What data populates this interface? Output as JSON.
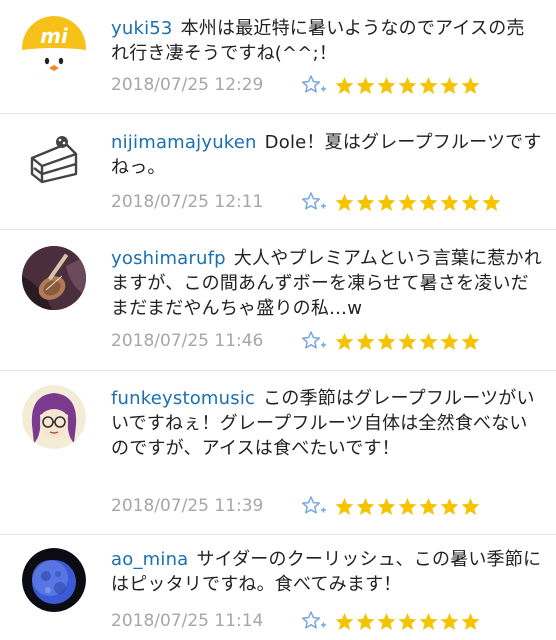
{
  "comments": [
    {
      "username": "yuki53",
      "text": "本州は最近特に暑いようなのでアイスの売れ行き凄そうですね(^^;！",
      "timestamp": "2018/07/25 12:29",
      "avatar_icon": "mi-logo-chick-avatar",
      "rating": 7
    },
    {
      "username": "nijimamajyuken",
      "text": "Dole！夏はグレープフルーツですねっ。",
      "timestamp": "2018/07/25 12:11",
      "avatar_icon": "cake-slice-avatar",
      "rating": 7
    },
    {
      "username": "yoshimarufp",
      "text": "大人やプレミアムという言葉に惹かれますが、この間あんずボーを凍らせて暑さを凌いだまだまだやんちゃ盛りの私…w",
      "timestamp": "2018/07/25 11:46",
      "avatar_icon": "guitar-photo-avatar",
      "rating": 7
    },
    {
      "username": "funkeystomusic",
      "text": "この季節はグレープフルーツがいいですねぇ！グレープフルーツ自体は全然食べないのですが、アイスは食べたいです！",
      "timestamp": "2018/07/25 11:39",
      "avatar_icon": "purple-hair-glasses-avatar",
      "rating": 7
    },
    {
      "username": "ao_mina",
      "text": "サイダーのクーリッシュ、この暑い季節にはピッタリですね。食べてみます！",
      "timestamp": "2018/07/25 11:14",
      "avatar_icon": "moon-avatar",
      "rating": 7
    }
  ],
  "colors": {
    "username": "#1a6fb3",
    "timestamp": "#a7a7a7",
    "star": "#f5c400",
    "fav_icon": "#7aa7de"
  },
  "icons": {
    "fav_button": "star-plus-icon",
    "rating_star": "star-icon"
  }
}
